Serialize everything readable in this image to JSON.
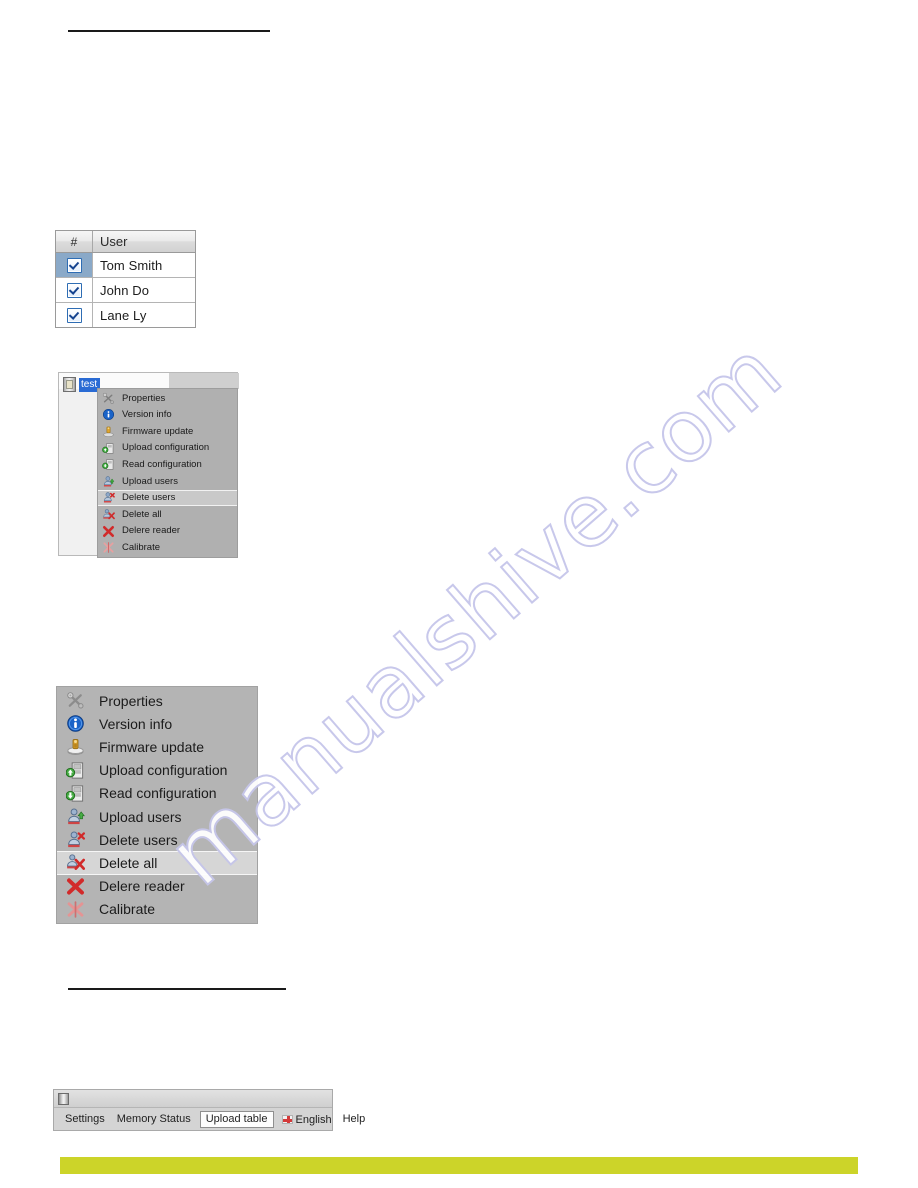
{
  "page": {
    "watermark_text": "manualshive.com",
    "accent_band_color": "#ccd429"
  },
  "user_table": {
    "headers": [
      "#",
      "User"
    ],
    "rows": [
      {
        "checked": true,
        "name": "Tom Smith",
        "selected": true
      },
      {
        "checked": true,
        "name": "John Do",
        "selected": false
      },
      {
        "checked": true,
        "name": "Lane Ly",
        "selected": false
      }
    ]
  },
  "small_window": {
    "device_label": "test",
    "device_icon": "reader-device-icon"
  },
  "small_menu": {
    "items": [
      {
        "label": "Properties",
        "icon": "wrench-screwdriver-icon",
        "highlight": false
      },
      {
        "label": "Version info",
        "icon": "blue-info-icon",
        "highlight": false
      },
      {
        "label": "Firmware update",
        "icon": "firmware-chip-icon",
        "highlight": false
      },
      {
        "label": "Upload configuration",
        "icon": "upload-configuration-icon",
        "highlight": false
      },
      {
        "label": "Read configuration",
        "icon": "read-configuration-icon",
        "highlight": false
      },
      {
        "label": "Upload users",
        "icon": "upload-users-icon",
        "highlight": false
      },
      {
        "label": "Delete users",
        "icon": "delete-users-icon",
        "highlight": true
      },
      {
        "label": "Delete all",
        "icon": "delete-all-icon",
        "highlight": false
      },
      {
        "label": "Delere reader",
        "icon": "delete-reader-icon",
        "highlight": false
      },
      {
        "label": "Calibrate",
        "icon": "calibrate-icon",
        "highlight": false
      }
    ]
  },
  "large_menu": {
    "items": [
      {
        "label": "Properties",
        "icon": "wrench-screwdriver-icon",
        "highlight": false
      },
      {
        "label": "Version info",
        "icon": "blue-info-icon",
        "highlight": false
      },
      {
        "label": "Firmware update",
        "icon": "firmware-chip-icon",
        "highlight": false
      },
      {
        "label": "Upload configuration",
        "icon": "upload-configuration-icon",
        "highlight": false
      },
      {
        "label": "Read configuration",
        "icon": "read-configuration-icon",
        "highlight": false
      },
      {
        "label": "Upload users",
        "icon": "upload-users-icon",
        "highlight": false
      },
      {
        "label": "Delete users",
        "icon": "delete-users-icon",
        "highlight": false
      },
      {
        "label": "Delete all",
        "icon": "delete-all-icon",
        "highlight": true
      },
      {
        "label": "Delere reader",
        "icon": "delete-reader-icon",
        "highlight": false
      },
      {
        "label": "Calibrate",
        "icon": "calibrate-icon",
        "highlight": false
      }
    ]
  },
  "bottom_toolbar": {
    "window_icon": "application-icon",
    "items": [
      {
        "label": "Settings",
        "boxed": false
      },
      {
        "label": "Memory Status",
        "boxed": false
      },
      {
        "label": "Upload table",
        "boxed": true
      }
    ],
    "language": {
      "label": "English",
      "icon": "flag-icon"
    },
    "help_label": "Help"
  }
}
